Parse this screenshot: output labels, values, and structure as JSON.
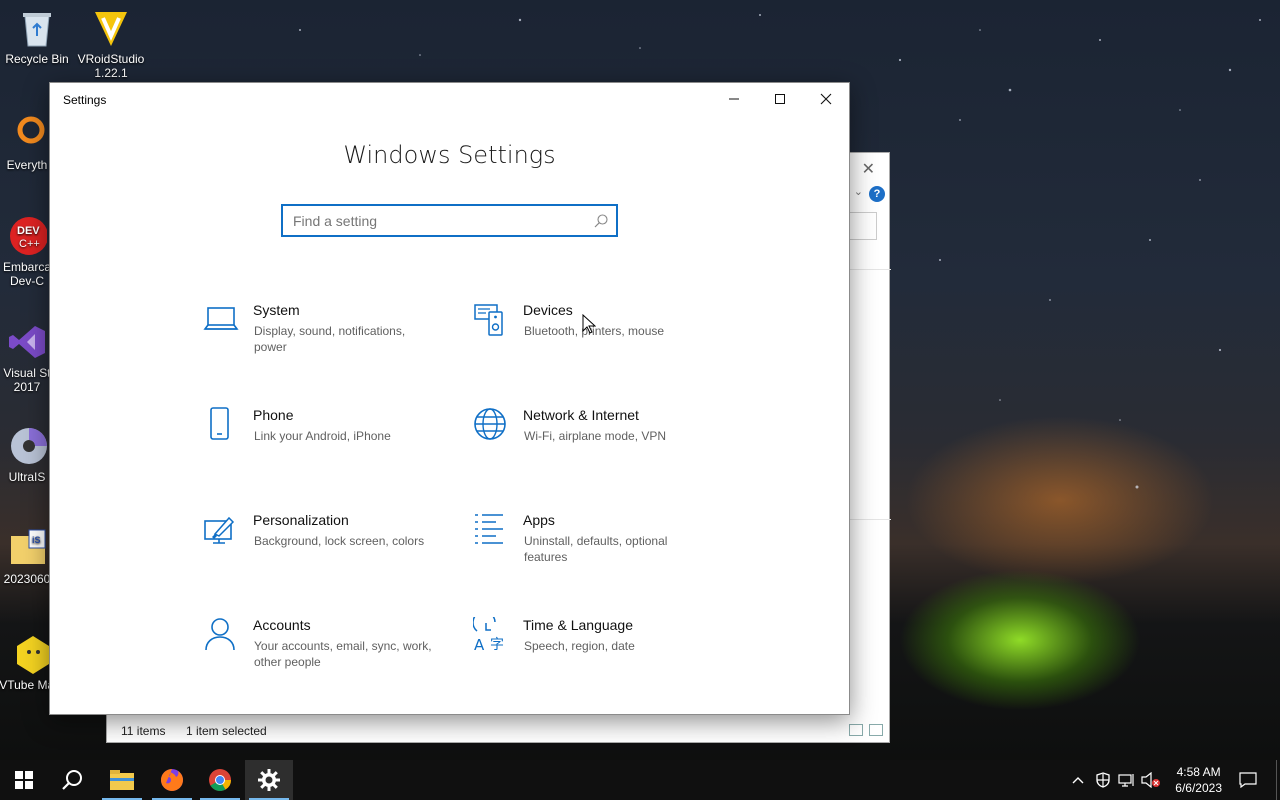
{
  "desktop": {
    "icons": [
      {
        "label": "Recycle Bin"
      },
      {
        "label": "VRoidStudio 1.22.1"
      },
      {
        "label": "Everyth"
      },
      {
        "label": "Embarca Dev-C"
      },
      {
        "label": "Visual St 2017"
      },
      {
        "label": "UltraIS"
      },
      {
        "label": "2023060"
      },
      {
        "label": "VTube Make"
      }
    ]
  },
  "explorer": {
    "close_glyph": "✕",
    "help_glyph": "?",
    "status": {
      "items": "11 items",
      "selected": "1 item selected"
    }
  },
  "settings": {
    "window_title": "Settings",
    "minimize_glyph": "—",
    "maximize_glyph": "☐",
    "close_glyph": "✕",
    "heading": "Windows Settings",
    "search": {
      "placeholder": "Find a setting",
      "value": ""
    },
    "accent_color": "#0f6fc6",
    "categories": [
      {
        "name": "System",
        "desc": "Display, sound, notifications, power",
        "icon": "laptop-icon"
      },
      {
        "name": "Devices",
        "desc": "Bluetooth, printers, mouse",
        "icon": "devices-icon"
      },
      {
        "name": "Phone",
        "desc": "Link your Android, iPhone",
        "icon": "phone-icon"
      },
      {
        "name": "Network & Internet",
        "desc": "Wi-Fi, airplane mode, VPN",
        "icon": "globe-icon"
      },
      {
        "name": "Personalization",
        "desc": "Background, lock screen, colors",
        "icon": "brush-icon"
      },
      {
        "name": "Apps",
        "desc": "Uninstall, defaults, optional features",
        "icon": "apps-list-icon"
      },
      {
        "name": "Accounts",
        "desc": "Your accounts, email, sync, work, other people",
        "icon": "person-icon"
      },
      {
        "name": "Time & Language",
        "desc": "Speech, region, date",
        "icon": "time-language-icon"
      }
    ]
  },
  "taskbar": {
    "apps": [
      "start-icon",
      "search-icon",
      "file-explorer-icon",
      "firefox-icon",
      "chrome-icon",
      "settings-gear-icon"
    ],
    "time": "4:58 AM",
    "date": "6/6/2023"
  }
}
